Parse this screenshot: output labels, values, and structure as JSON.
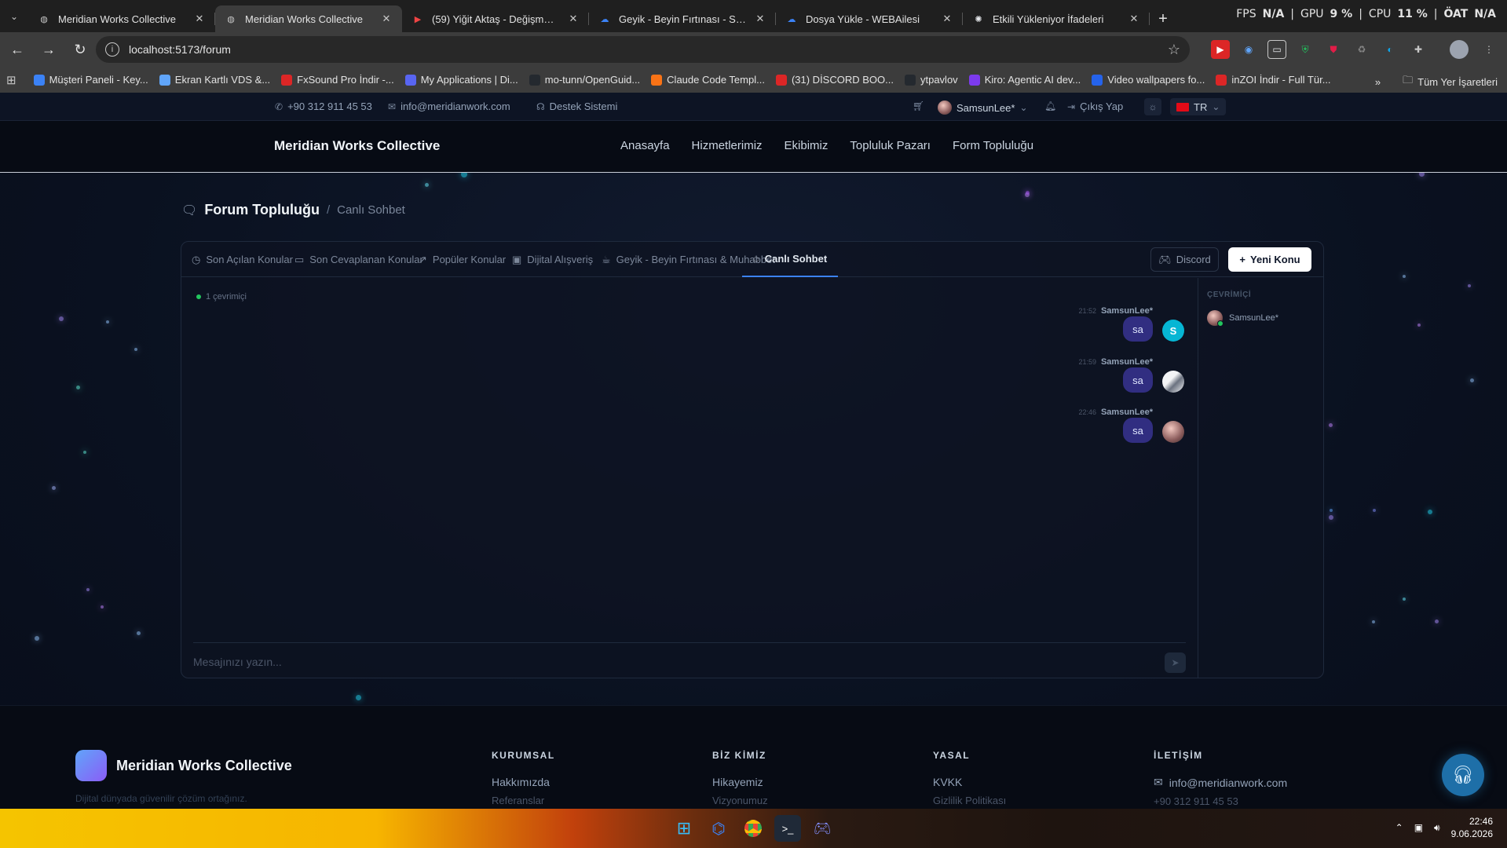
{
  "browser": {
    "tabs": [
      {
        "title": "Meridian Works Collective",
        "active": false,
        "favicon": "globe-icon"
      },
      {
        "title": "Meridian Works Collective",
        "active": true,
        "favicon": "globe-icon"
      },
      {
        "title": "(59) Yiğit Aktaş - Değişmem Ar",
        "active": false,
        "favicon": "youtube-icon"
      },
      {
        "title": "Geyik - Beyin Fırtınası - Sorum",
        "active": false,
        "favicon": "cloud-icon"
      },
      {
        "title": "Dosya Yükle - WEBAilesi",
        "active": false,
        "favicon": "cloud-icon"
      },
      {
        "title": "Etkili Yükleniyor İfadeleri",
        "active": false,
        "favicon": "chatgpt-icon"
      }
    ],
    "stats": {
      "fps_label": "FPS",
      "fps_value": "N/A",
      "gpu_label": "GPU",
      "gpu_value": "9 %",
      "cpu_label": "CPU",
      "cpu_value": "11 %",
      "extra_label": "ÖAT",
      "extra_value": "N/A"
    },
    "url": "localhost:5173/forum",
    "bookmarks": [
      {
        "label": "Müşteri Paneli - Key...",
        "color": "#3b82f6",
        "icon": "k-icon"
      },
      {
        "label": "Ekran Kartlı VDS &...",
        "color": "#60a5fa",
        "icon": "hawk-icon"
      },
      {
        "label": "FxSound Pro İndir -...",
        "color": "#dc2626",
        "icon": "fx-icon"
      },
      {
        "label": "My Applications | Di...",
        "color": "#5865f2",
        "icon": "discord-icon"
      },
      {
        "label": "mo-tunn/OpenGuid...",
        "color": "#24292f",
        "icon": "github-icon"
      },
      {
        "label": "Claude Code Templ...",
        "color": "#f97316",
        "icon": "claude-icon"
      },
      {
        "label": "(31) DİSCORD BOO...",
        "color": "#dc2626",
        "icon": "youtube-icon"
      },
      {
        "label": "ytpavlov",
        "color": "#24292f",
        "icon": "github-icon"
      },
      {
        "label": "Kiro: Agentic AI dev...",
        "color": "#7c3aed",
        "icon": "kiro-icon"
      },
      {
        "label": "Video wallpapers fo...",
        "color": "#2563eb",
        "icon": "v-icon"
      },
      {
        "label": "inZOI İndir - Full Tür...",
        "color": "#dc2626",
        "icon": "fx-icon"
      }
    ],
    "all_bookmarks": "Tüm Yer İşaretleri"
  },
  "topbar": {
    "phone": "+90 312 911 45 53",
    "email": "info@meridianwork.com",
    "support": "Destek Sistemi",
    "username": "SamsunLee*",
    "logout": "Çıkış Yap",
    "lang": "TR"
  },
  "nav": {
    "brand": "Meridian Works Collective",
    "links": [
      "Anasayfa",
      "Hizmetlerimiz",
      "Ekibimiz",
      "Topluluk Pazarı",
      "Form Topluluğu"
    ]
  },
  "breadcrumb": {
    "title": "Forum Topluluğu",
    "separator": "/",
    "current": "Canlı Sohbet"
  },
  "forum_tabs": [
    {
      "label": "Son Açılan Konular",
      "icon": "clock-icon",
      "active": false
    },
    {
      "label": "Son Cevaplanan Konular",
      "icon": "comment-icon",
      "active": false
    },
    {
      "label": "Popüler Konular",
      "icon": "trending-icon",
      "active": false
    },
    {
      "label": "Dijital Alışveriş",
      "icon": "bag-icon",
      "active": false
    },
    {
      "label": "Geyik - Beyin Fırtınası & Muhabbet",
      "icon": "coffee-icon",
      "active": false
    },
    {
      "label": "Canlı Sohbet",
      "icon": "chat-icon",
      "active": true
    }
  ],
  "buttons": {
    "discord": "Discord",
    "new_topic": "Yeni Konu"
  },
  "chat": {
    "online_count": "1 çevrimiçi",
    "messages": [
      {
        "time": "21:52",
        "user": "SamsunLee*",
        "text": "sa",
        "avatar_letter": "S",
        "avatar_color": "#06b6d4"
      },
      {
        "time": "21:59",
        "user": "SamsunLee*",
        "text": "sa",
        "avatar_letter": "",
        "avatar_color": "#e5e7eb"
      },
      {
        "time": "22:46",
        "user": "SamsunLee*",
        "text": "sa",
        "avatar_letter": "",
        "avatar_color": "#7a4b4b"
      }
    ],
    "placeholder": "Mesajınızı yazın...",
    "online_header": "ÇEVRİMİÇİ",
    "online_users": [
      "SamsunLee*"
    ]
  },
  "footer": {
    "brand": "Meridian Works Collective",
    "columns": [
      {
        "heading": "KURUMSAL",
        "link": "Hakkımızda",
        "more": "Referanslar"
      },
      {
        "heading": "BİZ KİMİZ",
        "link": "Hikayemiz",
        "more": "Vizyonumuz"
      },
      {
        "heading": "YASAL",
        "link": "KVKK",
        "more": "Gizlilik Politikası"
      },
      {
        "heading": "İLETİŞİM",
        "link": "info@meridianwork.com",
        "more": "+90 312 911 45 53"
      }
    ],
    "tagline": "Dijital dünyada güvenilir çözüm ortağınız."
  },
  "taskbar": {
    "time": "22:46",
    "date": "9.06.2026"
  }
}
